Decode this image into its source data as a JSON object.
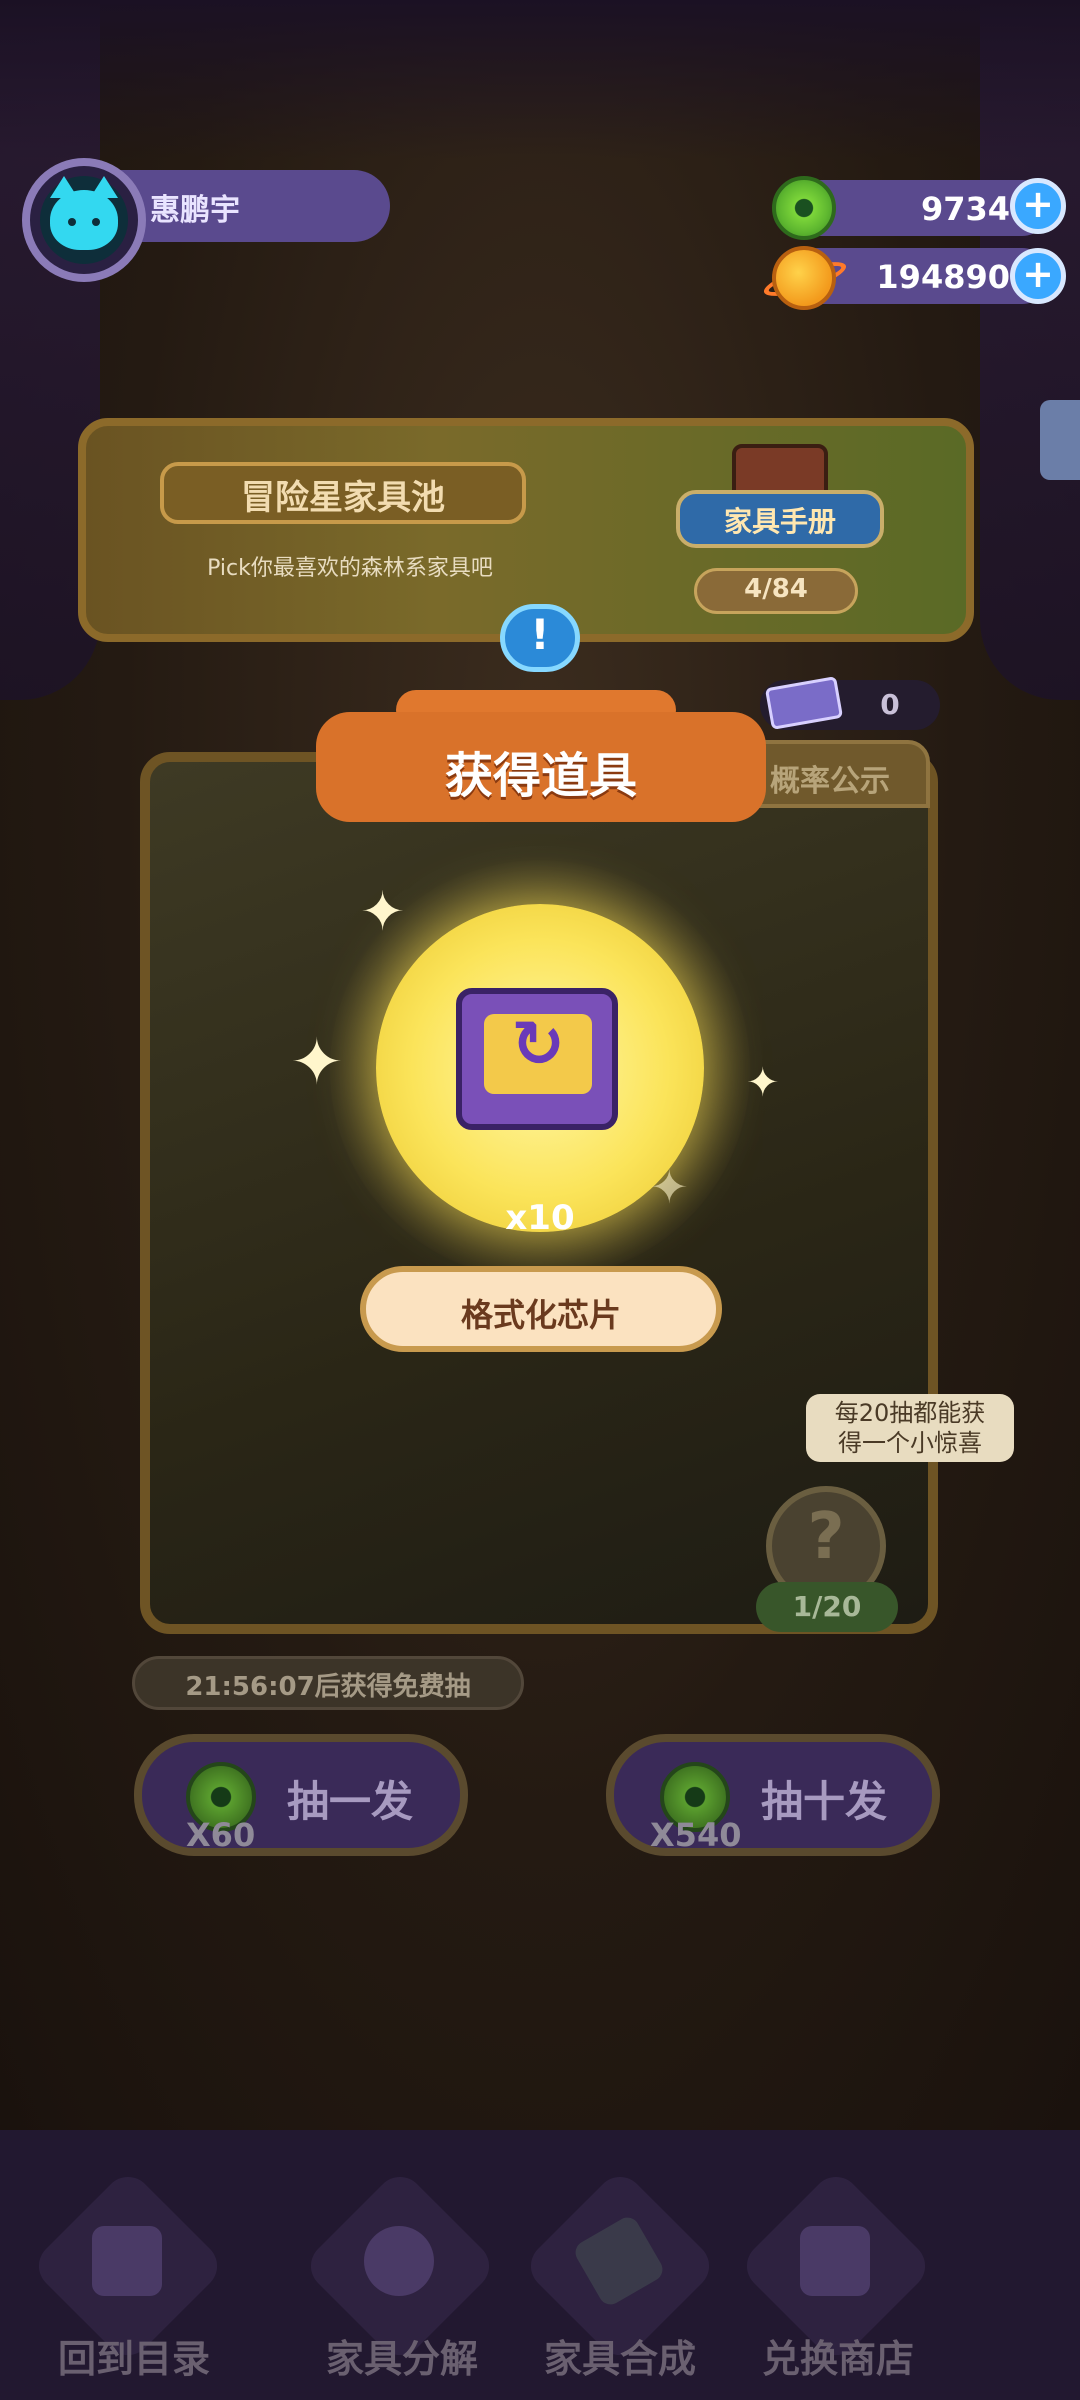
{
  "profile": {
    "name": "惠鹏宇"
  },
  "currency": {
    "gems": "9734",
    "coins": "194890"
  },
  "banner": {
    "title": "冒险星家具池",
    "subtitle": "Pick你最喜欢的森林系家具吧",
    "handbook_label": "家具手册",
    "handbook_progress": "4/84"
  },
  "alert_mark": "!",
  "ticket_count": "0",
  "probability_tab": "概率公示",
  "reward": {
    "title": "获得道具",
    "quantity": "x10",
    "item_name": "格式化芯片"
  },
  "bonus_hint": {
    "line1": "每20抽都能获",
    "line2": "得一个小惊喜"
  },
  "mystery": {
    "mark": "?",
    "progress": "1/20"
  },
  "timer_text": "21:56:07后获得免费抽",
  "draw": {
    "single": {
      "label": "抽一发",
      "cost": "X60"
    },
    "ten": {
      "label": "抽十发",
      "cost": "X540"
    }
  },
  "nav": [
    {
      "label": "回到目录",
      "icon": "back-card-icon"
    },
    {
      "label": "家具分解",
      "icon": "puzzle-icon"
    },
    {
      "label": "家具合成",
      "icon": "hammer-icon"
    },
    {
      "label": "兑换商店",
      "icon": "gift-icon"
    }
  ],
  "colors": {
    "accent_orange": "#d9722a",
    "profile_purple": "#5a4a8e",
    "plus_blue": "#3aa8ff",
    "glow_yellow": "#fbe45a"
  }
}
